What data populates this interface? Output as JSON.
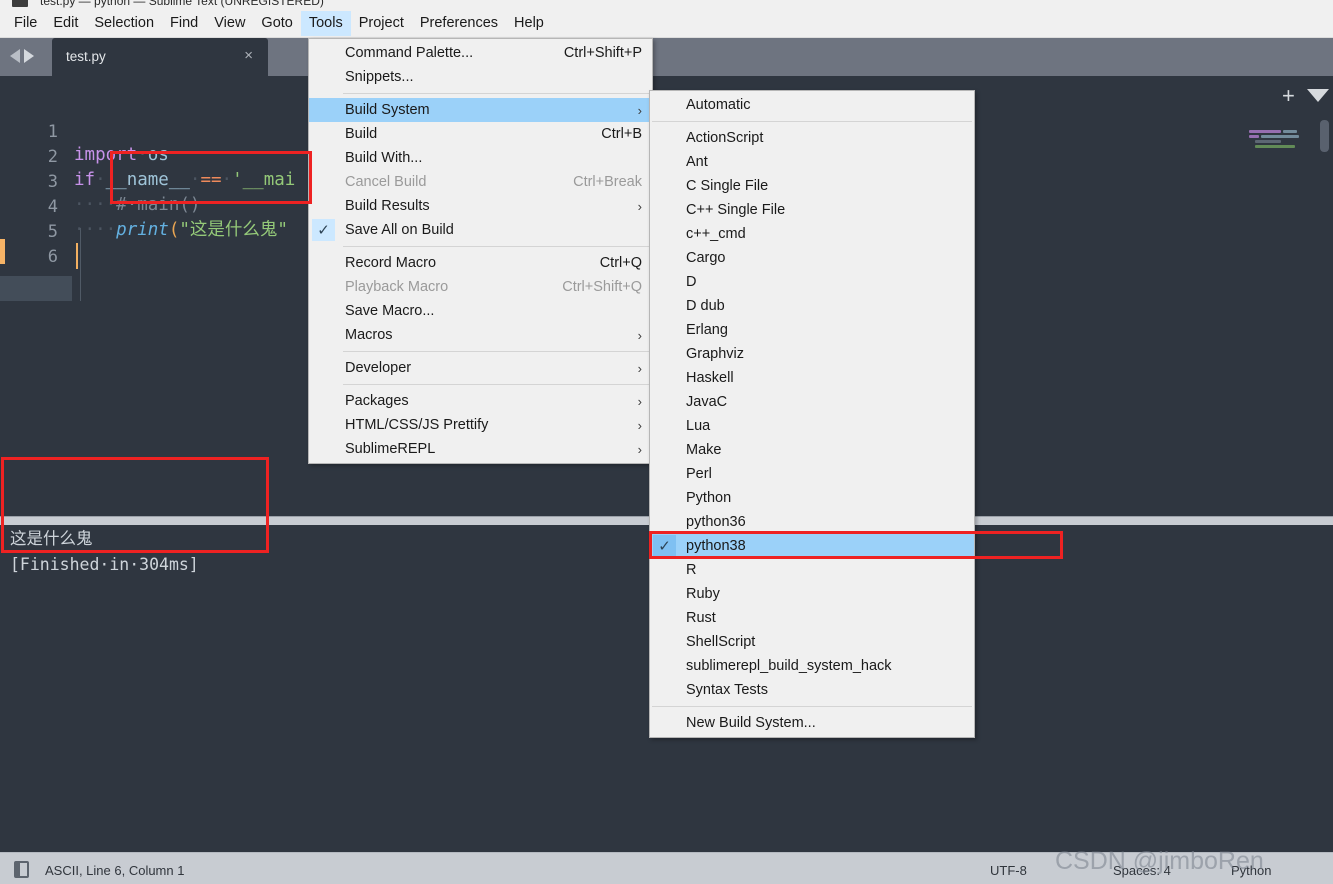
{
  "window": {
    "title": "test.py — python — Sublime Text (UNREGISTERED)"
  },
  "menubar": {
    "items": [
      {
        "label": "File",
        "active": false
      },
      {
        "label": "Edit",
        "active": false
      },
      {
        "label": "Selection",
        "active": false
      },
      {
        "label": "Find",
        "active": false
      },
      {
        "label": "View",
        "active": false
      },
      {
        "label": "Goto",
        "active": false
      },
      {
        "label": "Tools",
        "active": true
      },
      {
        "label": "Project",
        "active": false
      },
      {
        "label": "Preferences",
        "active": false
      },
      {
        "label": "Help",
        "active": false
      }
    ]
  },
  "tabbar": {
    "tab_label": "test.py",
    "close_glyph": "×",
    "new_tab_glyph": "+",
    "dropdown_glyph": "▼"
  },
  "editor": {
    "line_numbers": [
      "1",
      "2",
      "3",
      "4",
      "5",
      "6"
    ],
    "current_line": 6,
    "lines": [
      {
        "n": 1,
        "tokens": []
      },
      {
        "n": 2,
        "tokens": [
          {
            "t": "import",
            "c": "tok-kw"
          },
          {
            "t": "·",
            "c": "tok-dot"
          },
          {
            "t": "os",
            "c": "tok-name"
          }
        ]
      },
      {
        "n": 3,
        "tokens": [
          {
            "t": "if",
            "c": "tok-kw"
          },
          {
            "t": "·",
            "c": "tok-dot"
          },
          {
            "t": "__name__",
            "c": "tok-name"
          },
          {
            "t": "·",
            "c": "tok-dot"
          },
          {
            "t": "==",
            "c": "tok-op"
          },
          {
            "t": "·",
            "c": "tok-dot"
          },
          {
            "t": "'__mai",
            "c": "tok-str"
          }
        ]
      },
      {
        "n": 4,
        "tokens": [
          {
            "t": "····",
            "c": "tok-dot"
          },
          {
            "t": "#·main()",
            "c": "tok-comment"
          }
        ]
      },
      {
        "n": 5,
        "tokens": [
          {
            "t": "····",
            "c": "tok-dot"
          },
          {
            "t": "print",
            "c": "tok-fn"
          },
          {
            "t": "(",
            "c": "tok-punct"
          },
          {
            "t": "\"这是什么鬼\"",
            "c": "tok-str"
          }
        ]
      },
      {
        "n": 6,
        "tokens": []
      }
    ]
  },
  "console": {
    "lines": [
      "这是什么鬼",
      "[Finished·in·304ms]"
    ]
  },
  "statusbar": {
    "left": "ASCII, Line 6, Column 1",
    "encoding": "UTF-8",
    "indentation": "Spaces: 4",
    "syntax": "Python",
    "watermark": "CSDN @jimboRen"
  },
  "tools_menu": {
    "items": [
      {
        "label": "Command Palette...",
        "shortcut": "Ctrl+Shift+P",
        "type": "item"
      },
      {
        "label": "Snippets...",
        "shortcut": "",
        "type": "item"
      },
      {
        "type": "separator"
      },
      {
        "label": "Build System",
        "shortcut": "",
        "type": "submenu",
        "highlight": true,
        "arrow": "›"
      },
      {
        "label": "Build",
        "shortcut": "Ctrl+B",
        "type": "item"
      },
      {
        "label": "Build With...",
        "shortcut": "",
        "type": "item"
      },
      {
        "label": "Cancel Build",
        "shortcut": "Ctrl+Break",
        "type": "item",
        "disabled": true
      },
      {
        "label": "Build Results",
        "shortcut": "",
        "type": "submenu",
        "arrow": "›"
      },
      {
        "label": "Save All on Build",
        "shortcut": "",
        "type": "item",
        "checked": true
      },
      {
        "type": "separator"
      },
      {
        "label": "Record Macro",
        "shortcut": "Ctrl+Q",
        "type": "item"
      },
      {
        "label": "Playback Macro",
        "shortcut": "Ctrl+Shift+Q",
        "type": "item",
        "disabled": true
      },
      {
        "label": "Save Macro...",
        "shortcut": "",
        "type": "item"
      },
      {
        "label": "Macros",
        "shortcut": "",
        "type": "submenu",
        "arrow": "›"
      },
      {
        "type": "separator"
      },
      {
        "label": "Developer",
        "shortcut": "",
        "type": "submenu",
        "arrow": "›"
      },
      {
        "type": "separator"
      },
      {
        "label": "Packages",
        "shortcut": "",
        "type": "submenu",
        "arrow": "›"
      },
      {
        "label": "HTML/CSS/JS Prettify",
        "shortcut": "",
        "type": "submenu",
        "arrow": "›"
      },
      {
        "label": "SublimeREPL",
        "shortcut": "",
        "type": "submenu",
        "arrow": "›"
      }
    ]
  },
  "build_submenu": {
    "items": [
      {
        "label": "Automatic",
        "type": "item"
      },
      {
        "type": "separator"
      },
      {
        "label": "ActionScript",
        "type": "item"
      },
      {
        "label": "Ant",
        "type": "item"
      },
      {
        "label": "C Single File",
        "type": "item"
      },
      {
        "label": "C++ Single File",
        "type": "item"
      },
      {
        "label": "c++_cmd",
        "type": "item"
      },
      {
        "label": "Cargo",
        "type": "item"
      },
      {
        "label": "D",
        "type": "item"
      },
      {
        "label": "D dub",
        "type": "item"
      },
      {
        "label": "Erlang",
        "type": "item"
      },
      {
        "label": "Graphviz",
        "type": "item"
      },
      {
        "label": "Haskell",
        "type": "item"
      },
      {
        "label": "JavaC",
        "type": "item"
      },
      {
        "label": "Lua",
        "type": "item"
      },
      {
        "label": "Make",
        "type": "item"
      },
      {
        "label": "Perl",
        "type": "item"
      },
      {
        "label": "Python",
        "type": "item"
      },
      {
        "label": "python36",
        "type": "item"
      },
      {
        "label": "python38",
        "type": "item",
        "checked": true,
        "highlight": true
      },
      {
        "label": "R",
        "type": "item"
      },
      {
        "label": "Ruby",
        "type": "item"
      },
      {
        "label": "Rust",
        "type": "item"
      },
      {
        "label": "ShellScript",
        "type": "item"
      },
      {
        "label": "sublimerepl_build_system_hack",
        "type": "item"
      },
      {
        "label": "Syntax Tests",
        "type": "item"
      },
      {
        "type": "separator"
      },
      {
        "label": "New Build System...",
        "type": "item"
      }
    ]
  },
  "annotations": {
    "color": "#ee2222",
    "boxes": [
      {
        "name": "code-highlight-box"
      },
      {
        "name": "output-highlight-box"
      },
      {
        "name": "build-system-highlight-box"
      }
    ]
  },
  "theme": {
    "editor_bg": "#2f3640",
    "tabbar_bg": "#6e7480",
    "menu_bg": "#f0f0f0",
    "menu_highlight": "#9bd1f9",
    "statusbar_bg": "#c8ccd2",
    "accent_red": "#ee2222"
  }
}
